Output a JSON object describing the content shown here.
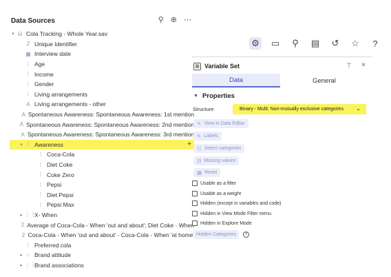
{
  "data_sources": {
    "title": "Data Sources",
    "search_icon": "search-icon",
    "add_icon": "add-circle-icon",
    "more_icon": "more-icon"
  },
  "tree": [
    {
      "caret": "▾",
      "icon": "db",
      "label": "Cola Tracking - Whole Year.sav",
      "indent": 0
    },
    {
      "caret": "",
      "icon": "2",
      "label": "Unique Identifier",
      "indent": 1
    },
    {
      "caret": "",
      "icon": "cal",
      "label": "Interview date",
      "indent": 1
    },
    {
      "caret": "",
      "icon": "dots",
      "label": "Age",
      "indent": 1
    },
    {
      "caret": "",
      "icon": "dots",
      "label": "Income",
      "indent": 1
    },
    {
      "caret": "",
      "icon": "dots",
      "label": "Gender",
      "indent": 1
    },
    {
      "caret": "",
      "icon": "dots",
      "label": "Living arrangements",
      "indent": 1
    },
    {
      "caret": "",
      "icon": "A",
      "label": "Living arrangements - other",
      "indent": 1
    },
    {
      "caret": "",
      "icon": "A",
      "label": "Spontaneous Awareness: Spontaneous Awareness: 1st mention",
      "indent": 1
    },
    {
      "caret": "",
      "icon": "A",
      "label": "Spontaneous Awareness: Spontaneous Awareness: 2nd mention",
      "indent": 1
    },
    {
      "caret": "",
      "icon": "A",
      "label": "Spontaneous Awareness: Spontaneous Awareness: 3rd mention",
      "indent": 1
    },
    {
      "caret": "▾",
      "icon": "dots",
      "label": "Awareness",
      "indent": 1,
      "highlight": true
    },
    {
      "caret": "",
      "icon": "dots",
      "label": "Coca-Cola",
      "indent": 2
    },
    {
      "caret": "",
      "icon": "dots",
      "label": "Diet Coke",
      "indent": 2
    },
    {
      "caret": "",
      "icon": "dots",
      "label": "Coke Zero",
      "indent": 2
    },
    {
      "caret": "",
      "icon": "dots",
      "label": "Pepsi",
      "indent": 2
    },
    {
      "caret": "",
      "icon": "dots",
      "label": "Diet Pepsi",
      "indent": 2
    },
    {
      "caret": "",
      "icon": "dots",
      "label": "Pepsi Max",
      "indent": 2
    },
    {
      "caret": "▸",
      "icon": "grid",
      "label": "X- When",
      "indent": 1
    },
    {
      "caret": "",
      "icon": "2",
      "label": "Average of Coca-Cola - When 'out and about'; Diet Coke - When",
      "indent": 1
    },
    {
      "caret": "",
      "icon": "2",
      "label": "Coca-Cola - When 'out and about' - Coca-Cola - When 'at home'",
      "indent": 1
    },
    {
      "caret": "",
      "icon": "dots",
      "label": "Preferred cola",
      "indent": 1
    },
    {
      "caret": "▸",
      "icon": "dots4",
      "label": "Brand attitude",
      "indent": 1
    },
    {
      "caret": "▸",
      "icon": "grid",
      "label": "Brand associations",
      "indent": 1
    }
  ],
  "awareness_plus": "+",
  "toolbar": [
    "sliders-icon",
    "comment-icon",
    "search-icon",
    "notes-icon",
    "history-icon",
    "star-icon",
    "help-icon"
  ],
  "variable_set": {
    "title": "Variable Set",
    "pin": "⊤",
    "close": "×",
    "tabs": [
      "Data",
      "General"
    ],
    "properties_title": "Properties",
    "structure_label": "Structure",
    "structure_value": "Binary - Multi: Non-mutually exclusive categories",
    "actions": [
      "View in Data Editor",
      "Labels",
      "Select categories",
      "Missing values",
      "Reset"
    ],
    "checkboxes": [
      "Usable as a filter",
      "Usable as a weight",
      "Hidden (except in variables and code)",
      "Hidden in View Mode Filter menu",
      "Hidden in Explore Mode"
    ],
    "hidden_categories": "Hidden Categories"
  },
  "colors": {
    "highlight": "#fbf35a",
    "accent": "#3a4bb0",
    "icon": "#8c8fb5"
  }
}
